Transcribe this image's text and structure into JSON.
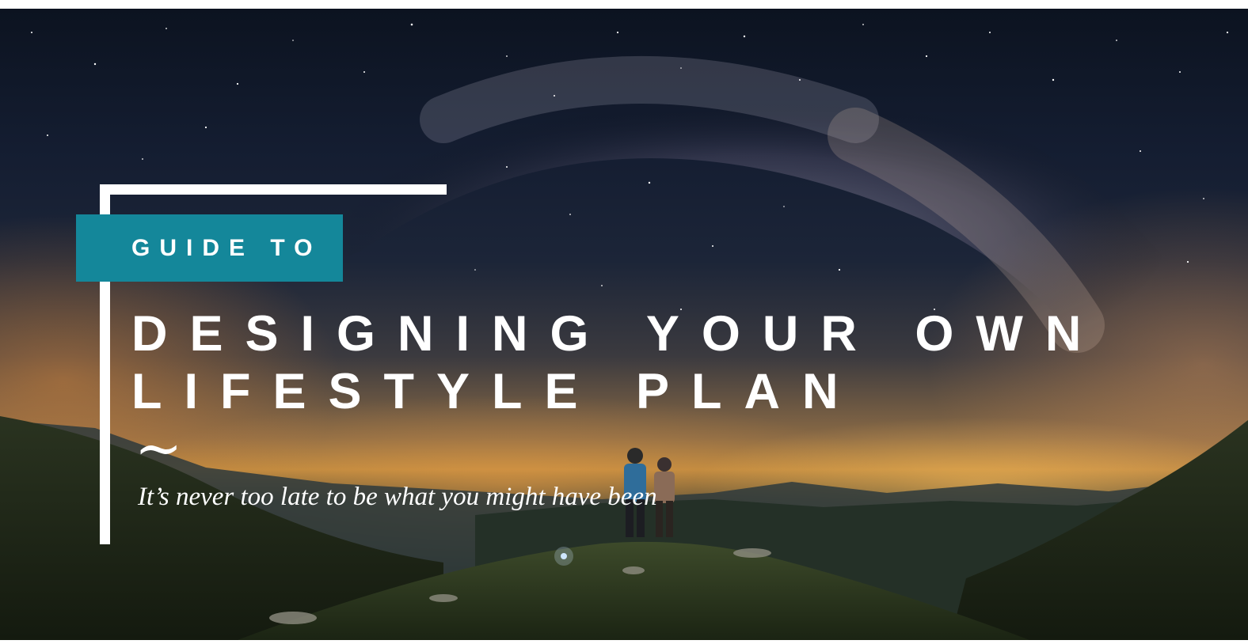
{
  "hero": {
    "image": "milky-way-night-sky-over-mountains-with-two-hikers"
  },
  "tag": {
    "label": "GUIDE TO"
  },
  "title": {
    "line1": "DESIGNING YOUR OWN",
    "line2": "LIFESTYLE PLAN"
  },
  "decoration": {
    "tilde": "~"
  },
  "tagline": "It’s never too late to be what you might have been",
  "colors": {
    "accent": "#14879a",
    "frame": "#ffffff",
    "text": "#ffffff"
  }
}
